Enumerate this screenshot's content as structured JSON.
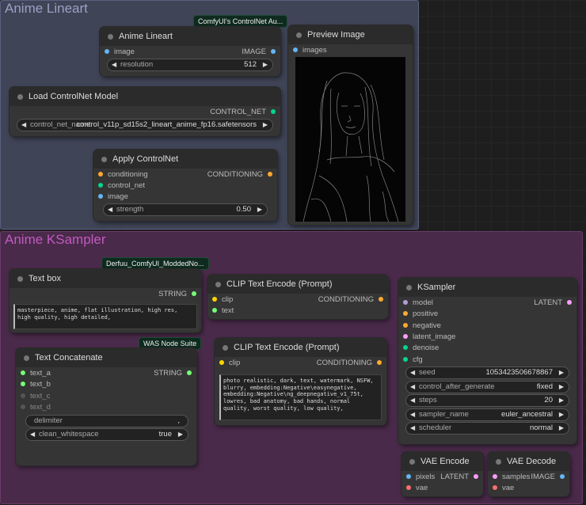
{
  "colors": {
    "group_lineart_bg": "#3f4456",
    "group_lineart_title": "#9aa1c4",
    "group_ksampler_bg": "#4a2a4a",
    "group_ksampler_title": "#c15ac1",
    "node_bg": "#353535",
    "image_slot": "#64b5f6",
    "controlnet_slot": "#00d78d",
    "conditioning_slot": "#ffa931",
    "model_slot": "#b39ddb",
    "latent_slot": "#ff9cf9",
    "clip_slot": "#ffd500",
    "string_slot": "#77ff77",
    "vae_slot": "#ff6e6e"
  },
  "groups": {
    "lineart": {
      "title": "Anime Lineart"
    },
    "ksampler": {
      "title": "Anime KSampler"
    }
  },
  "badges": {
    "controlnet_aux": "ComfyUI's ControlNet Au...",
    "derfuu": "Derfuu_ComfyUI_ModdedNo...",
    "was": "WAS Node Suite"
  },
  "nodes": {
    "anime_lineart": {
      "title": "Anime Lineart",
      "input_image": "image",
      "output_image": "IMAGE",
      "resolution_label": "resolution",
      "resolution_value": "512"
    },
    "load_controlnet": {
      "title": "Load ControlNet Model",
      "output": "CONTROL_NET",
      "name_label": "control_net_name",
      "name_value": "control_v11p_sd15s2_lineart_anime_fp16.safetensors"
    },
    "apply_controlnet": {
      "title": "Apply ControlNet",
      "in_conditioning": "conditioning",
      "in_control_net": "control_net",
      "in_image": "image",
      "output": "CONDITIONING",
      "strength_label": "strength",
      "strength_value": "0.50"
    },
    "preview_image": {
      "title": "Preview Image",
      "input": "images",
      "preview_icon": "lineart-preview-image"
    },
    "text_box": {
      "title": "Text box",
      "output": "STRING",
      "text": "masterpiece, anime, flat illustration, high res, high quality, high detailed,"
    },
    "text_concatenate": {
      "title": "Text Concatenate",
      "in_a": "text_a",
      "in_b": "text_b",
      "in_c": "text_c",
      "in_d": "text_d",
      "output": "STRING",
      "delimiter_label": "delimiter",
      "delimiter_value": ",",
      "clean_label": "clean_whitespace",
      "clean_value": "true"
    },
    "clip_pos": {
      "title": "CLIP Text Encode (Prompt)",
      "in_clip": "clip",
      "in_text": "text",
      "output": "CONDITIONING"
    },
    "clip_neg": {
      "title": "CLIP Text Encode (Prompt)",
      "in_clip": "clip",
      "output": "CONDITIONING",
      "text": "photo realistic, dark, text, watermark, NSFW, blurry, embedding:Negative\\easynegative, embedding:Negative\\ng_deepnegative_v1_75t, lowres, bad anatomy, bad hands, normal quality, worst quality, low quality,"
    },
    "ksampler": {
      "title": "KSampler",
      "in_model": "model",
      "in_positive": "positive",
      "in_negative": "negative",
      "in_latent": "latent_image",
      "in_denoise": "denoise",
      "in_cfg": "cfg",
      "output": "LATENT",
      "seed_label": "seed",
      "seed_value": "1053423506678867",
      "control_label": "control_after_generate",
      "control_value": "fixed",
      "steps_label": "steps",
      "steps_value": "20",
      "sampler_label": "sampler_name",
      "sampler_value": "euler_ancestral",
      "scheduler_label": "scheduler",
      "scheduler_value": "normal"
    },
    "vae_encode": {
      "title": "VAE Encode",
      "in_pixels": "pixels",
      "in_vae": "vae",
      "output": "LATENT"
    },
    "vae_decode": {
      "title": "VAE Decode",
      "in_samples": "samples",
      "in_vae": "vae",
      "output": "IMAGE"
    }
  }
}
